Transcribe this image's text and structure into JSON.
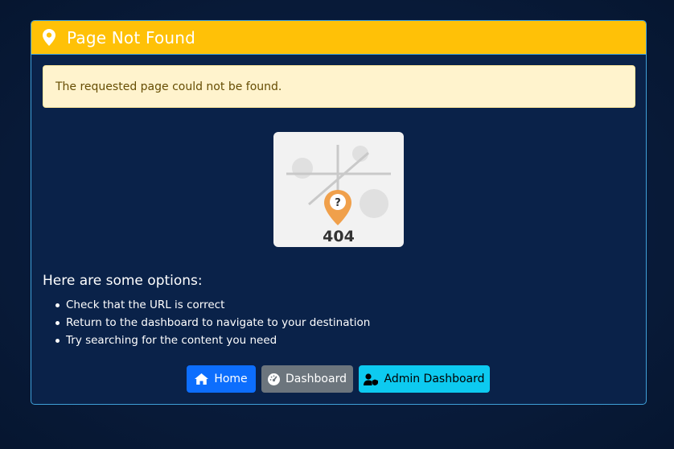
{
  "header": {
    "title": "Page Not Found",
    "icon": "map-marker-icon"
  },
  "alert": {
    "message": "The requested page could not be found."
  },
  "illustration": {
    "code": "404",
    "marker_symbol": "?"
  },
  "options": {
    "title": "Here are some options:",
    "items": [
      "Check that the URL is correct",
      "Return to the dashboard to navigate to your destination",
      "Try searching for the content you need"
    ]
  },
  "buttons": {
    "home": {
      "label": "Home",
      "icon": "home-icon"
    },
    "dashboard": {
      "label": "Dashboard",
      "icon": "gauge-icon"
    },
    "admin": {
      "label": "Admin Dashboard",
      "icon": "user-shield-icon"
    }
  },
  "colors": {
    "header": "#ffc107",
    "alert_bg": "#fff3cd",
    "primary": "#0d6efd",
    "secondary": "#6c757d",
    "info": "#0dcaf0"
  }
}
